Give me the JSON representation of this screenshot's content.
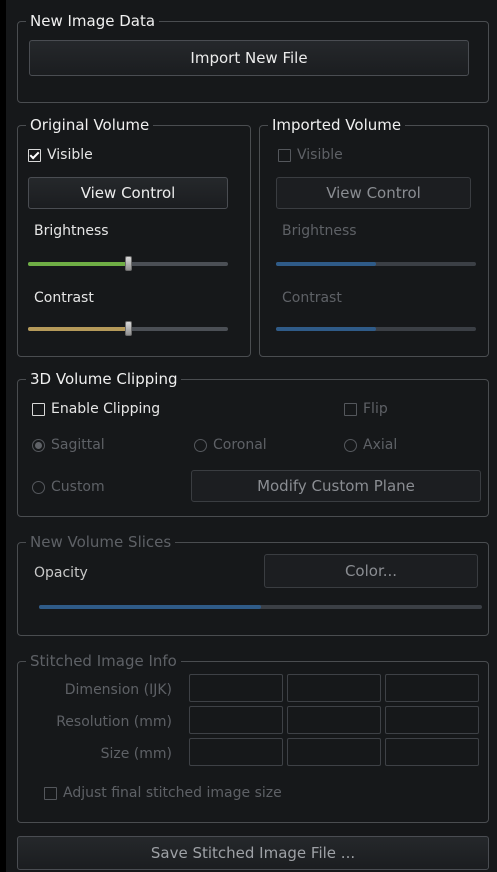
{
  "new_image_data": {
    "title": "New Image Data",
    "import_button": "Import New File"
  },
  "original_volume": {
    "title": "Original Volume",
    "visible_label": "Visible",
    "visible_checked": true,
    "view_control": "View Control",
    "brightness_label": "Brightness",
    "brightness_value": 0.5,
    "contrast_label": "Contrast",
    "contrast_value": 0.5,
    "brightness_color": "#6fae45",
    "contrast_color": "#b59a5a"
  },
  "imported_volume": {
    "title": "Imported Volume",
    "visible_label": "Visible",
    "visible_checked": false,
    "view_control": "View Control",
    "brightness_label": "Brightness",
    "brightness_value": 0.5,
    "contrast_label": "Contrast",
    "contrast_value": 0.5,
    "slider_color": "#2f5b88"
  },
  "clipping": {
    "title": "3D Volume Clipping",
    "enable_label": "Enable Clipping",
    "enable_checked": false,
    "flip_label": "Flip",
    "sagittal_label": "Sagittal",
    "coronal_label": "Coronal",
    "axial_label": "Axial",
    "custom_label": "Custom",
    "selected_plane": "Sagittal",
    "modify_button": "Modify Custom Plane"
  },
  "slices": {
    "title": "New Volume Slices",
    "opacity_label": "Opacity",
    "color_button": "Color...",
    "opacity_value": 0.5,
    "slider_color": "#2f5b88"
  },
  "stitched_info": {
    "title": "Stitched Image Info",
    "rows": [
      {
        "label": "Dimension (IJK)"
      },
      {
        "label": "Resolution (mm)"
      },
      {
        "label": "Size (mm)"
      }
    ],
    "adjust_label": "Adjust final stitched image size",
    "adjust_checked": false
  },
  "save_button": "Save Stitched Image File ..."
}
